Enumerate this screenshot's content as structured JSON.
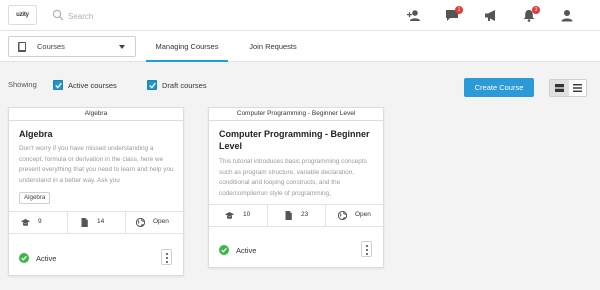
{
  "app": {
    "logo_text": "uzity"
  },
  "search": {
    "placeholder": "Search",
    "value": ""
  },
  "topbar": {
    "icons": [
      "add-user-icon",
      "chat-icon",
      "megaphone-icon",
      "bell-icon",
      "user-icon"
    ],
    "chat_badge": "1",
    "notifications_badge": "3"
  },
  "subbar": {
    "select_value": "Courses",
    "select_icon": "book-icon",
    "tabs": [
      {
        "label": "Managing Courses",
        "active": true
      },
      {
        "label": "Join Requests",
        "active": false
      }
    ]
  },
  "filters": {
    "showing_label": "Showing",
    "active_label": "Active courses",
    "active_checked": true,
    "draft_label": "Draft courses",
    "draft_checked": true
  },
  "actions": {
    "create_label": "Create Course"
  },
  "view_toggle": {
    "active": "grid",
    "options": [
      "grid-icon",
      "list-icon"
    ]
  },
  "colors": {
    "accent": "#2b9ad6",
    "tab_underline": "#1f9fd6",
    "active_status": "#3cb54a",
    "badge": "#e53935"
  },
  "courses": [
    {
      "header": "Algebra",
      "title": "Algebra",
      "description": "Don't worry if you have missed understanding a concept, formula or derivation in the class, here we present everything that you need to learn and help you understand in a better way. Ask you",
      "tag": "Algebra",
      "members": "9",
      "resources": "14",
      "visibility": "Open",
      "status": "Active"
    },
    {
      "header": "Computer Programming - Beginner Level",
      "title": "Computer Programming - Beginner Level",
      "description": "This tutorial introduces basic programming concepts such as program structure, variable declaration, conditional and looping constructs, and the code/compile/run style of programming,",
      "tag": "",
      "members": "10",
      "resources": "23",
      "visibility": "Open",
      "status": "Active"
    }
  ]
}
